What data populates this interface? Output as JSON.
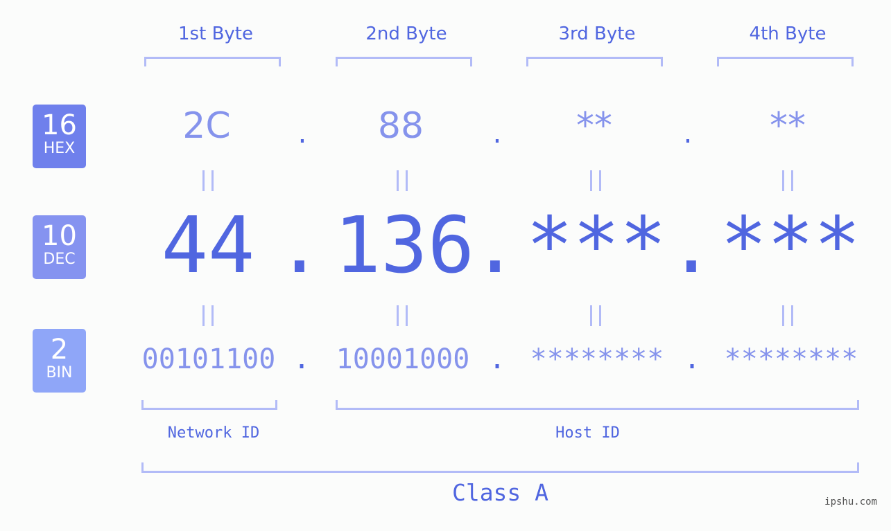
{
  "bytes": {
    "labels": [
      "1st Byte",
      "2nd Byte",
      "3rd Byte",
      "4th Byte"
    ]
  },
  "badges": {
    "hex": {
      "num": "16",
      "label": "HEX",
      "color": "#6f80ec"
    },
    "dec": {
      "num": "10",
      "label": "DEC",
      "color": "#8593f0"
    },
    "bin": {
      "num": "2",
      "label": "BIN",
      "color": "#8fa6f8"
    }
  },
  "hex": [
    "2C",
    "88",
    "**",
    "**"
  ],
  "dec": [
    "44",
    "136",
    "***",
    "***"
  ],
  "bin": [
    "00101100",
    "10001000",
    "********",
    "********"
  ],
  "separator": ".",
  "equals": "=",
  "ids": {
    "network": "Network ID",
    "host": "Host ID"
  },
  "class_label": "Class A",
  "watermark": "ipshu.com",
  "colors": {
    "primary": "#5066e0",
    "light": "#8593ec",
    "bracket": "#b2bbf7",
    "background": "#fbfcfb"
  }
}
